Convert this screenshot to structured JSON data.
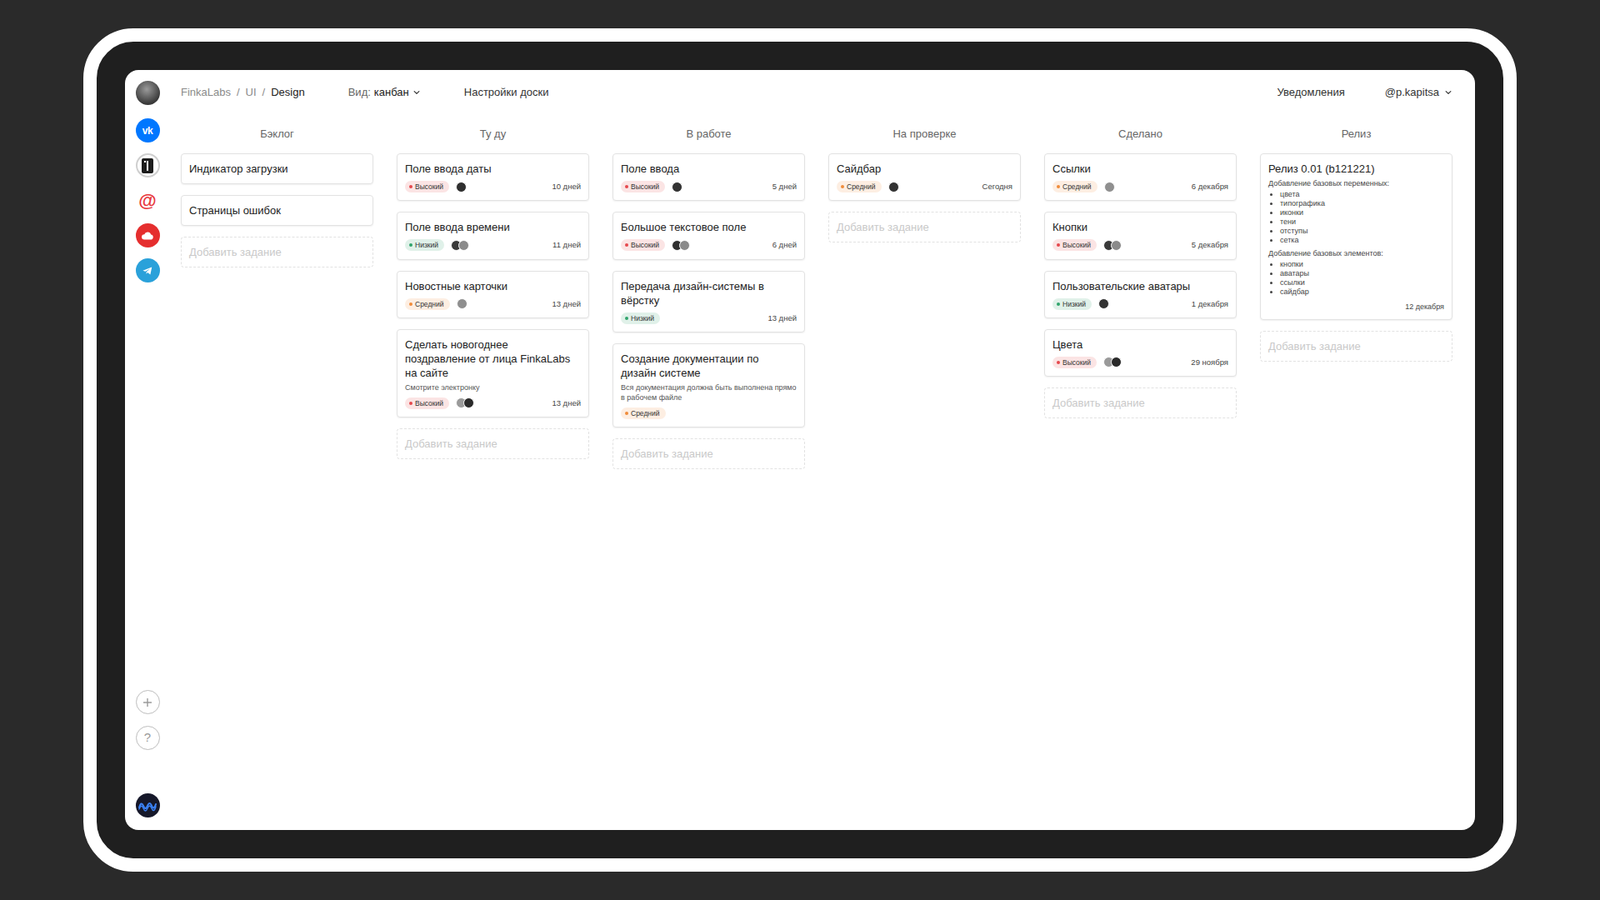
{
  "breadcrumbs": {
    "separator": "/",
    "items": [
      {
        "label": "FinkaLabs",
        "selected": false
      },
      {
        "label": "UI",
        "selected": false
      },
      {
        "label": "Design",
        "selected": true
      }
    ]
  },
  "view": {
    "label": "Вид:",
    "value": "канбан"
  },
  "board_settings": "Настройки доски",
  "notifications": "Уведомления",
  "user": "@p.kapitsa",
  "sidebar": {
    "apps": [
      {
        "kind": "vk",
        "glyph": "vk",
        "selected": false
      },
      {
        "kind": "frame",
        "selected": true
      },
      {
        "kind": "mail",
        "glyph": "@",
        "selected": false
      },
      {
        "kind": "cloud",
        "selected": false
      },
      {
        "kind": "telegram",
        "selected": false
      }
    ],
    "actions": [
      {
        "kind": "add"
      },
      {
        "kind": "help",
        "glyph": "?"
      }
    ]
  },
  "columns": [
    {
      "title": "Бэклог",
      "add_label": "Добавить задание",
      "cards": [
        {
          "kind": "simple",
          "title": "Индикатор загрузки"
        },
        {
          "kind": "simple",
          "title": "Страницы ошибок"
        }
      ]
    },
    {
      "title": "Ту ду",
      "add_label": "Добавить задание",
      "cards": [
        {
          "kind": "task",
          "title": "Поле ввода даты",
          "priority": {
            "label": "Высокий",
            "color": "#e5484d"
          },
          "avatars": [
            {
              "color": "#2f2f2f"
            }
          ],
          "due": "10 дней"
        },
        {
          "kind": "task",
          "title": "Поле ввода времени",
          "priority": {
            "label": "Низкий",
            "color": "#30a46c"
          },
          "avatars": [
            {
              "color": "#3a3a3a"
            },
            {
              "color": "#8a8a8a"
            }
          ],
          "due": "11 дней"
        },
        {
          "kind": "task",
          "title": "Новостные карточки",
          "priority": {
            "label": "Средний",
            "color": "#f08c3a"
          },
          "avatars": [
            {
              "color": "#8f8f8f"
            }
          ],
          "due": "13 дней"
        },
        {
          "kind": "task",
          "title": "Сделать новогоднее поздравление от лица FinkaLabs на сайте",
          "description": "Смотрите электронку",
          "priority": {
            "label": "Высокий",
            "color": "#e5484d"
          },
          "avatars": [
            {
              "color": "#9a9a9a"
            },
            {
              "color": "#2a2a2a"
            }
          ],
          "due": "13 дней"
        }
      ]
    },
    {
      "title": "В работе",
      "add_label": "Добавить задание",
      "cards": [
        {
          "kind": "task",
          "title": "Поле ввода",
          "priority": {
            "label": "Высокий",
            "color": "#e5484d"
          },
          "avatars": [
            {
              "color": "#333333"
            }
          ],
          "due": "5 дней"
        },
        {
          "kind": "task",
          "title": "Большое текстовое поле",
          "priority": {
            "label": "Высокий",
            "color": "#e5484d"
          },
          "avatars": [
            {
              "color": "#2f2f2f"
            },
            {
              "color": "#8a8a8a"
            }
          ],
          "due": "6 дней"
        },
        {
          "kind": "task",
          "title": "Передача дизайн-системы в вёрстку",
          "priority": {
            "label": "Низкий",
            "color": "#30a46c"
          },
          "avatars": [],
          "due": "13 дней"
        },
        {
          "kind": "task",
          "title": "Создание документации по дизайн системе",
          "description": "Вся документация должна быть выполнена прямо в рабочем файле",
          "priority": {
            "label": "Средний",
            "color": "#f08c3a"
          },
          "avatars": []
        }
      ]
    },
    {
      "title": "На проверке",
      "add_label": "Добавить задание",
      "cards": [
        {
          "kind": "task",
          "title": "Сайдбар",
          "priority": {
            "label": "Средний",
            "color": "#f08c3a"
          },
          "avatars": [
            {
              "color": "#333333"
            }
          ],
          "due": "Сегодня"
        }
      ]
    },
    {
      "title": "Сделано",
      "add_label": "Добавить задание",
      "cards": [
        {
          "kind": "task",
          "title": "Ссылки",
          "priority": {
            "label": "Средний",
            "color": "#f08c3a"
          },
          "avatars": [
            {
              "color": "#8f8f8f"
            }
          ],
          "due": "6 декабря"
        },
        {
          "kind": "task",
          "title": "Кнопки",
          "priority": {
            "label": "Высокий",
            "color": "#e5484d"
          },
          "avatars": [
            {
              "color": "#3a3a3a"
            },
            {
              "color": "#8a8a8a"
            }
          ],
          "due": "5 декабря"
        },
        {
          "kind": "task",
          "title": "Пользовательские аватары",
          "priority": {
            "label": "Низкий",
            "color": "#30a46c"
          },
          "avatars": [
            {
              "color": "#333333"
            }
          ],
          "due": "1 декабря"
        },
        {
          "kind": "task",
          "title": "Цвета",
          "priority": {
            "label": "Высокий",
            "color": "#e5484d"
          },
          "avatars": [
            {
              "color": "#9a9a9a"
            },
            {
              "color": "#2a2a2a"
            }
          ],
          "due": "29 ноября"
        }
      ]
    },
    {
      "title": "Релиз",
      "add_label": "Добавить задание",
      "cards": [
        {
          "kind": "release",
          "title": "Релиз 0.01 (b121221)",
          "sections": [
            {
              "heading": "Добавление базовых переменных:",
              "items": [
                "цвета",
                "типографика",
                "иконки",
                "тени",
                "отступы",
                "сетка"
              ]
            },
            {
              "heading": "Добавление базовых элементов:",
              "items": [
                "кнопки",
                "аватары",
                "ссылки",
                "сайдбар"
              ]
            }
          ],
          "due": "12 декабря"
        }
      ]
    }
  ]
}
